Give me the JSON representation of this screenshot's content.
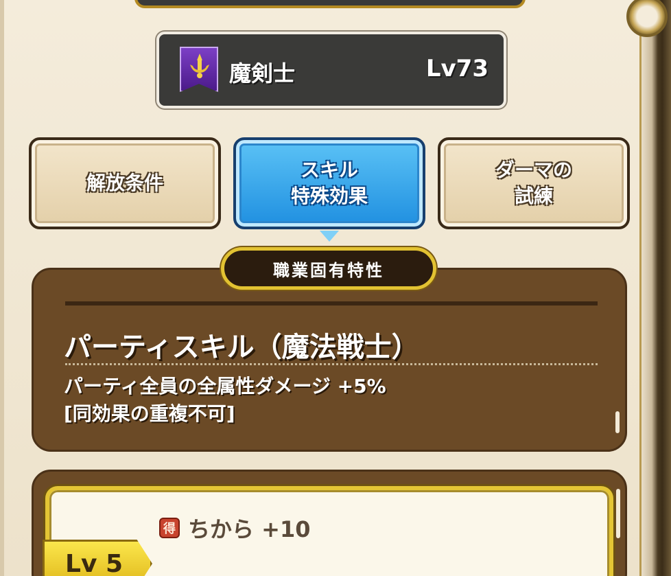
{
  "job": {
    "name": "魔剣士",
    "level": "Lv73",
    "emblem_icon": "purple-crest-icon"
  },
  "tabs": [
    {
      "lines": [
        "解放条件"
      ],
      "active": false
    },
    {
      "lines": [
        "スキル",
        "特殊効果"
      ],
      "active": true
    },
    {
      "lines": [
        "ダーマの",
        "試練"
      ],
      "active": false
    }
  ],
  "trait": {
    "badge": "職業固有特性",
    "title": "パーティスキル（魔法戦士）",
    "desc_line1": "パーティ全員の全属性ダメージ +5%",
    "desc_line2": "[同効果の重複不可]"
  },
  "bonus": {
    "icon_label": "得",
    "text": "ちから +10",
    "level_tag": "Lv 5"
  },
  "colors": {
    "active_tab": "#1f8fe0",
    "panel_brown": "#6b4a26",
    "gold": "#e2c232"
  }
}
